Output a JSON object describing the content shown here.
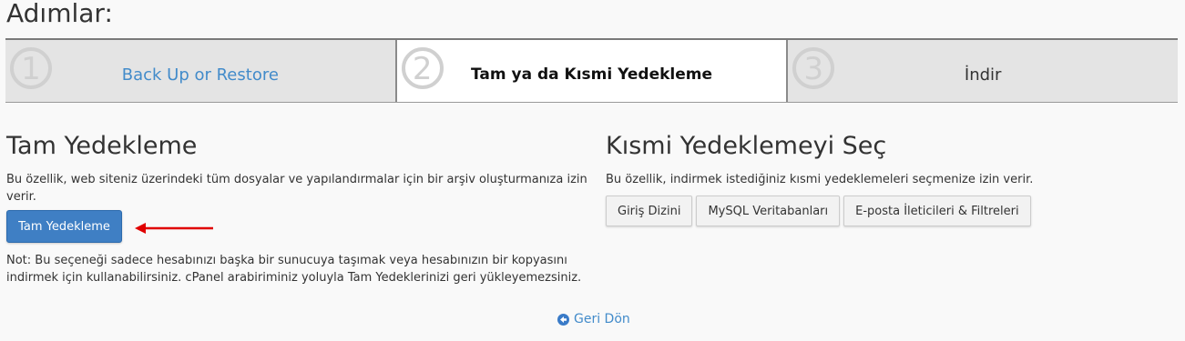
{
  "page": {
    "heading": "Adımlar:"
  },
  "steps": [
    {
      "number": "1",
      "label": "Back Up or Restore"
    },
    {
      "number": "2",
      "label": "Tam ya da Kısmi Yedekleme"
    },
    {
      "number": "3",
      "label": "İndir"
    }
  ],
  "full_backup": {
    "title": "Tam Yedekleme",
    "description": "Bu özellik, web siteniz üzerindeki tüm dosyalar ve yapılandırmalar için bir arşiv oluşturmanıza izin verir.",
    "button_label": "Tam Yedekleme",
    "note": "Not: Bu seçeneği sadece hesabınızı başka bir sunucuya taşımak veya hesabınızın bir kopyasını indirmek için kullanabilirsiniz. cPanel arabiriminiz yoluyla Tam Yedeklerinizi geri yükleyemezsiniz."
  },
  "partial_backup": {
    "title": "Kısmi Yedeklemeyi Seç",
    "description": "Bu özellik, indirmek istediğiniz kısmi yedeklemeleri seçmenize izin verir.",
    "buttons": [
      "Giriş Dizini",
      "MySQL Veritabanları",
      "E-posta İleticileri & Filtreleri"
    ]
  },
  "footer": {
    "back_label": "Geri Dön"
  },
  "colors": {
    "link": "#428bca",
    "primary_button": "#3f7fc4",
    "arrow": "#e00000"
  }
}
